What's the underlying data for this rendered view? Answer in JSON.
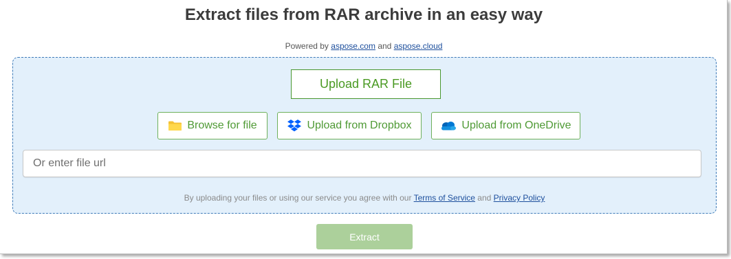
{
  "header": {
    "title": "Extract files from RAR archive in an easy way",
    "powered_by": "Powered by",
    "powered_link_1": "aspose.com",
    "powered_and": "and",
    "powered_link_2": "aspose.cloud"
  },
  "upload": {
    "main_button": "Upload RAR File",
    "sources": [
      {
        "label": "Browse for file",
        "icon": "folder-icon"
      },
      {
        "label": "Upload from Dropbox",
        "icon": "dropbox-icon"
      },
      {
        "label": "Upload from OneDrive",
        "icon": "onedrive-icon"
      }
    ],
    "url_placeholder": "Or enter file url",
    "url_value": ""
  },
  "terms": {
    "prefix": "By uploading your files or using our service you agree with our",
    "tos_link": "Terms of Service",
    "and": "and",
    "privacy_link": "Privacy Policy"
  },
  "actions": {
    "extract_label": "Extract",
    "extract_enabled": false
  },
  "colors": {
    "accent_green": "#4a9a23",
    "dropzone_bg": "#e3f0fb",
    "dropzone_border": "#3d7ab8",
    "extract_disabled": "#acd09b",
    "link": "#1c4e9c"
  }
}
